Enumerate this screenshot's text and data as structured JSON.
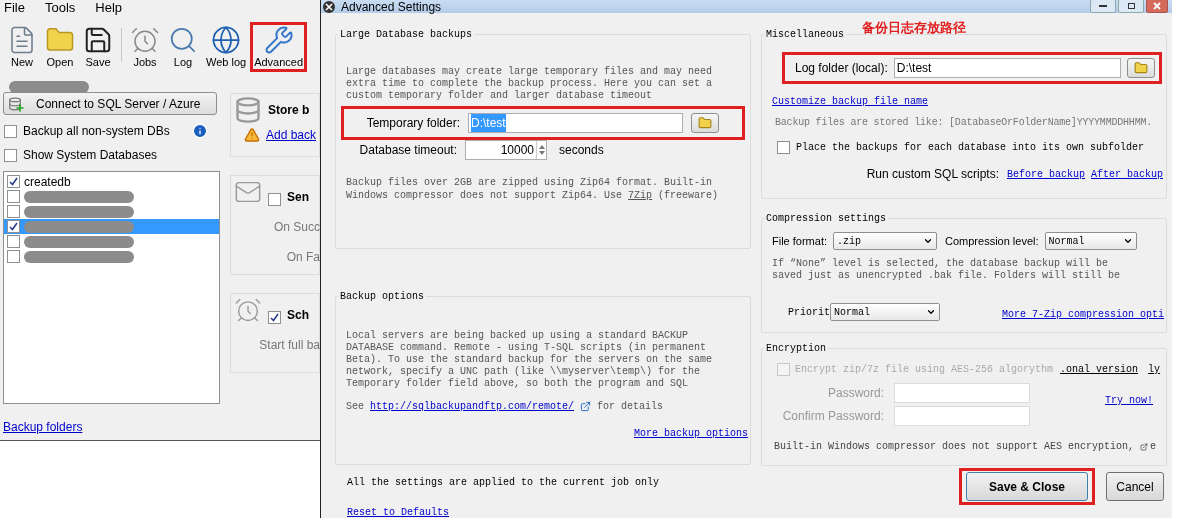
{
  "main_window": {
    "menu": [
      "File",
      "Tools",
      "Help"
    ],
    "toolbar": [
      {
        "label": "New",
        "highlighted": false
      },
      {
        "label": "Open",
        "highlighted": false
      },
      {
        "label": "Save",
        "highlighted": false
      },
      {
        "label": "Jobs",
        "highlighted": false
      },
      {
        "label": "Log",
        "highlighted": false
      },
      {
        "label": "Web log",
        "highlighted": false
      },
      {
        "label": "Advanced",
        "highlighted": true
      }
    ],
    "server_name": {
      "redacted": true
    },
    "connect_button": "Connect to SQL Server / Azure",
    "options": [
      {
        "label": "Backup all non-system DBs",
        "checked": false
      },
      {
        "label": "Show System Databases",
        "checked": false
      }
    ],
    "databases": [
      {
        "label": "createdb",
        "checked": true,
        "selected": false,
        "redacted": false
      },
      {
        "checked": false,
        "selected": false,
        "redacted": true
      },
      {
        "checked": false,
        "selected": false,
        "redacted": true
      },
      {
        "checked": true,
        "selected": true,
        "redacted": true
      },
      {
        "checked": false,
        "selected": false,
        "redacted": true
      },
      {
        "checked": false,
        "selected": false,
        "redacted": true
      }
    ],
    "backup_folders_link": "Backup folders",
    "cards": [
      {
        "title": "Store b",
        "link": "Add back"
      },
      {
        "title": "Sen",
        "checked": false,
        "lines": [
          "On Succ",
          "On Fa"
        ]
      },
      {
        "title": "Sch",
        "checked": true,
        "lines": [
          "Start full ba"
        ]
      }
    ]
  },
  "dialog": {
    "title": "Advanced Settings",
    "large_db": {
      "title": "Large Database backups",
      "description": "Large databases may create large temporary files and may need extra time to complete the backup process. Here you can set a custom temporary folder and larger database timeout",
      "temp_folder": {
        "label": "Temporary folder:",
        "value": "D:\\test",
        "highlighted": true
      },
      "timeout": {
        "label": "Database timeout:",
        "value": "10000",
        "unit": "seconds"
      },
      "zip64_note": "Backup files over 2GB are zipped using Zip64 format. Built-in Windows compressor does not support Zip64. Use",
      "zip64_link": "7Zip",
      "zip64_tail": "(freeware)"
    },
    "backup_options": {
      "title": "Backup options",
      "description": "Local servers are being backed up using a standard BACKUP DATABASE command. Remote - using T-SQL scripts (in permanent Beta). To use the standard backup for the servers on the same network, specify a UNC path (like \\\\myserver\\temp\\) for the Temporary folder field above, so both the program and SQL",
      "see": "See",
      "link": "http://sqlbackupandftp.com/remote/",
      "see_tail": "for details",
      "more_link": "More backup options"
    },
    "footer_note": "All the settings are applied to the current job only",
    "reset_link": "Reset to Defaults",
    "miscellaneous": {
      "title": "Miscellaneous",
      "annotation": "备份日志存放路径",
      "log_folder": {
        "label": "Log folder (local):",
        "value": "D:\\test",
        "highlighted": true
      },
      "customize_link": "Customize backup file name",
      "stored_like": "Backup files are stored like: [DatabaseOrFolderName]YYYYMMDDHHMM.",
      "subfolder": {
        "label": "Place the backups for each database into its own subfolder",
        "checked": false
      },
      "scripts_label": "Run custom SQL scripts:",
      "scripts_links": [
        "Before backup",
        "After backup"
      ]
    },
    "compression": {
      "title": "Compression settings",
      "file_format": {
        "label": "File format:",
        "value": ".zip"
      },
      "level": {
        "label": "Compression level:",
        "value": "Normal"
      },
      "note": "If “None” level is selected, the database backup will be saved just as unencrypted .bak file. Folders will still be",
      "priority": {
        "label": "Priorit",
        "value": "Normal"
      },
      "more_link": "More 7-Zip compression opti"
    },
    "encryption": {
      "title": "Encryption",
      "encrypt": {
        "label": "Encrypt zip/7z file using AES-256 algorythm",
        "checked": false,
        "disabled": true
      },
      "pro_link": ".onal version",
      "pro_tail": "ly",
      "password": "Password:",
      "confirm": "Confirm Password:",
      "try_link": "Try now!",
      "note": "Built-in Windows compressor does not support AES encryption,",
      "note_tail": "e"
    },
    "buttons": [
      {
        "label": "Save & Close",
        "highlighted": true,
        "default": true
      },
      {
        "label": "Cancel",
        "highlighted": false,
        "default": false
      }
    ]
  }
}
